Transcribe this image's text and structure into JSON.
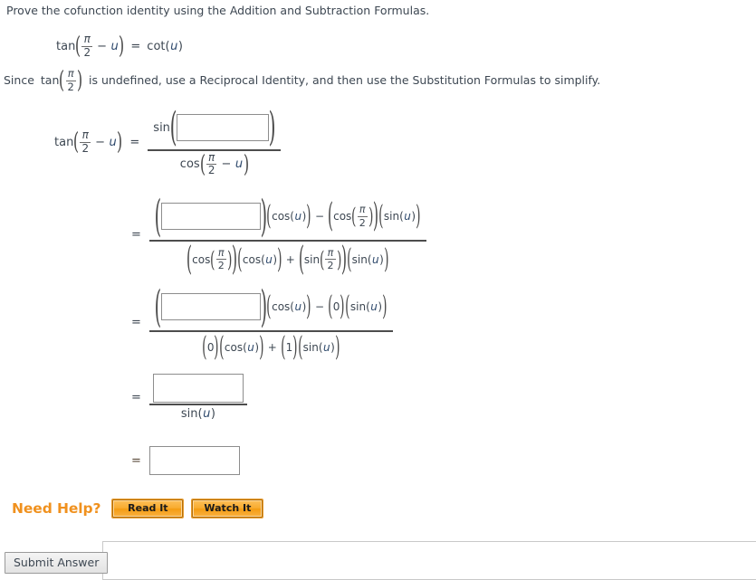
{
  "prompt": {
    "line1": "Prove the cofunction identity using the Addition and Subtraction Formulas.",
    "line2_before": "Since",
    "line2_after": "is undefined, use a Reciprocal Identity, and then use the Substitution Formulas to simplify."
  },
  "symbols": {
    "pi": "π",
    "two": "2",
    "u": "u",
    "minus": "−",
    "plus": "+",
    "equals": "=",
    "lparen": "(",
    "rparen": ")",
    "tan": "tan",
    "cos": "cos",
    "sin": "sin",
    "cot": "cot",
    "zero": "0",
    "one": "1"
  },
  "identity": {
    "lhs_fn": "tan",
    "lhs_arg_num": "π",
    "lhs_arg_den": "2",
    "lhs_arg_minus": "−",
    "lhs_arg_var": "u",
    "rhs_fn": "cot",
    "rhs_var": "u"
  },
  "steps": [
    {
      "id": "step-1",
      "label": "tan",
      "has_lhs": true,
      "numerator": {
        "fn": "sin",
        "input_value": "",
        "input_placeholder": ""
      },
      "denominator": {
        "fn": "cos",
        "num": "π",
        "den": "2",
        "minus": "−",
        "var": "u"
      }
    },
    {
      "id": "step-2",
      "has_lhs": false,
      "numerator_terms": {
        "input_value": "",
        "factor1": "cos",
        "factor1_arg": "u",
        "operator": "−",
        "factor2": "cos",
        "factor2_num": "π",
        "factor2_den": "2",
        "factor3": "sin",
        "factor3_arg": "u"
      },
      "denominator_terms": {
        "factor1": "cos",
        "factor1_num": "π",
        "factor1_den": "2",
        "factor2": "cos",
        "factor2_arg": "u",
        "operator": "+",
        "factor3": "sin",
        "factor3_num": "π",
        "factor3_den": "2",
        "factor4": "sin",
        "factor4_arg": "u"
      }
    },
    {
      "id": "step-3",
      "has_lhs": false,
      "numerator_terms": {
        "input_value": "",
        "factor1": "cos",
        "factor1_arg": "u",
        "operator": "−",
        "factor2_value": "0",
        "factor3": "sin",
        "factor3_arg": "u"
      },
      "denominator_terms": {
        "factor1_value": "0",
        "factor2": "cos",
        "factor2_arg": "u",
        "operator": "+",
        "factor3_value": "1",
        "factor4": "sin",
        "factor4_arg": "u"
      }
    },
    {
      "id": "step-4",
      "has_lhs": false,
      "numerator": {
        "input_value": ""
      },
      "denominator": {
        "fn": "sin",
        "arg": "u"
      }
    },
    {
      "id": "step-5",
      "has_lhs": false,
      "final_input_value": ""
    }
  ],
  "need_help": {
    "label": "Need Help?",
    "buttons": [
      {
        "name": "read-it",
        "label": "Read It"
      },
      {
        "name": "watch-it",
        "label": "Watch It"
      }
    ]
  },
  "submit": {
    "label": "Submit Answer"
  },
  "colors": {
    "accent_orange": "#f0911e",
    "button_orange": "#f8ab2e",
    "text": "#3d4752",
    "variable": "#2f4a6d",
    "input_border": "#8d8d8d"
  }
}
